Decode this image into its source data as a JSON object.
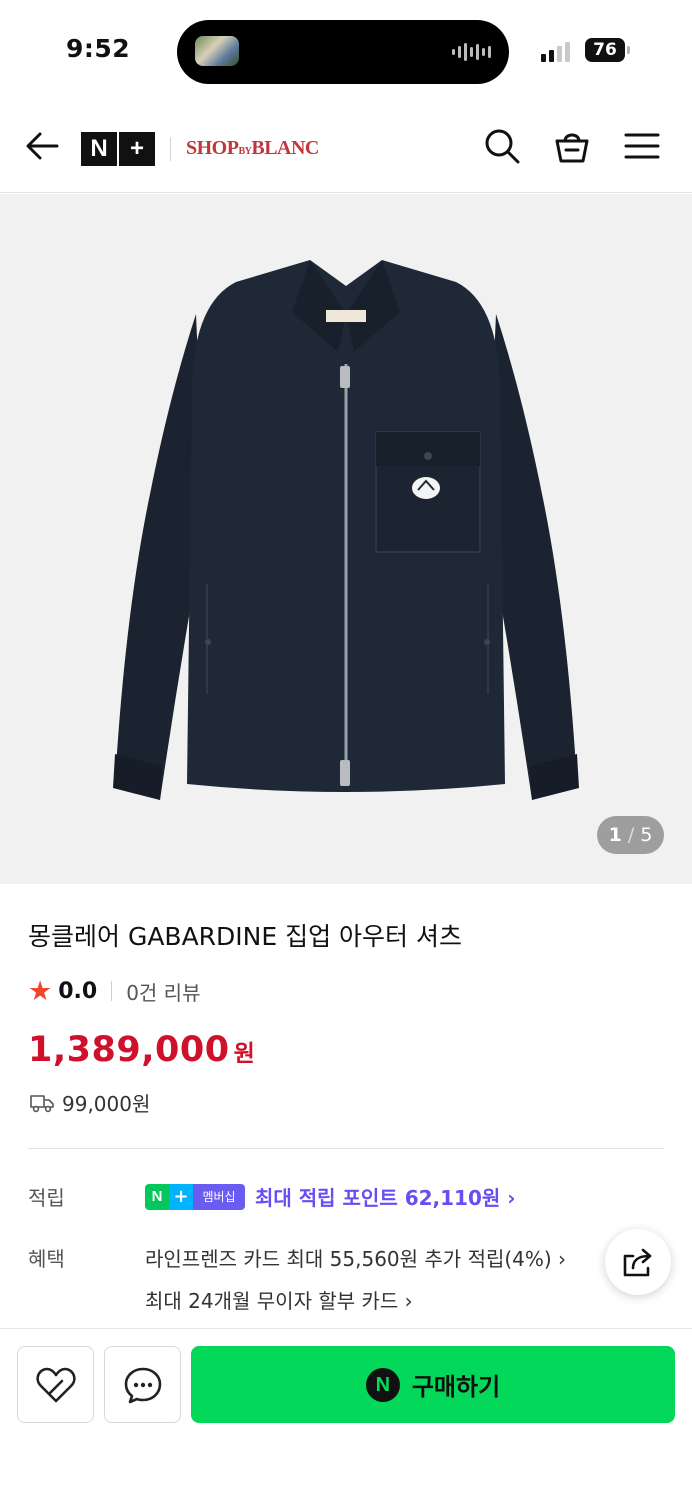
{
  "status_bar": {
    "time": "9:52",
    "battery": "76"
  },
  "header": {
    "logo_np": [
      "N",
      "+"
    ],
    "shop_logo_main": "SHOP",
    "shop_logo_small": "BY",
    "shop_logo_end": "BLANC"
  },
  "gallery": {
    "current": "1",
    "separator": "/",
    "total": "5"
  },
  "product": {
    "title": "몽클레어 GABARDINE 집업 아우터 셔츠",
    "rating": "0.0",
    "reviews": "0건 리뷰",
    "price": "1,389,000",
    "currency": "원",
    "shipping": "99,000원"
  },
  "points": {
    "label": "적립",
    "badge_n": "N",
    "badge_plus": "+",
    "badge_member": "멤버십",
    "text": "최대 적립 포인트 62,110원 ›"
  },
  "benefits": {
    "label": "혜택",
    "line1": "라인프렌즈 카드 최대 55,560원 추가 적립(4%) ›",
    "line2": "최대 24개월 무이자 할부 카드 ›"
  },
  "bottom_bar": {
    "buy_icon": "N",
    "buy_label": "구매하기"
  },
  "colors": {
    "accent_green": "#03d85a",
    "price_red": "#d0112b",
    "points_purple": "#6a4cf2"
  }
}
